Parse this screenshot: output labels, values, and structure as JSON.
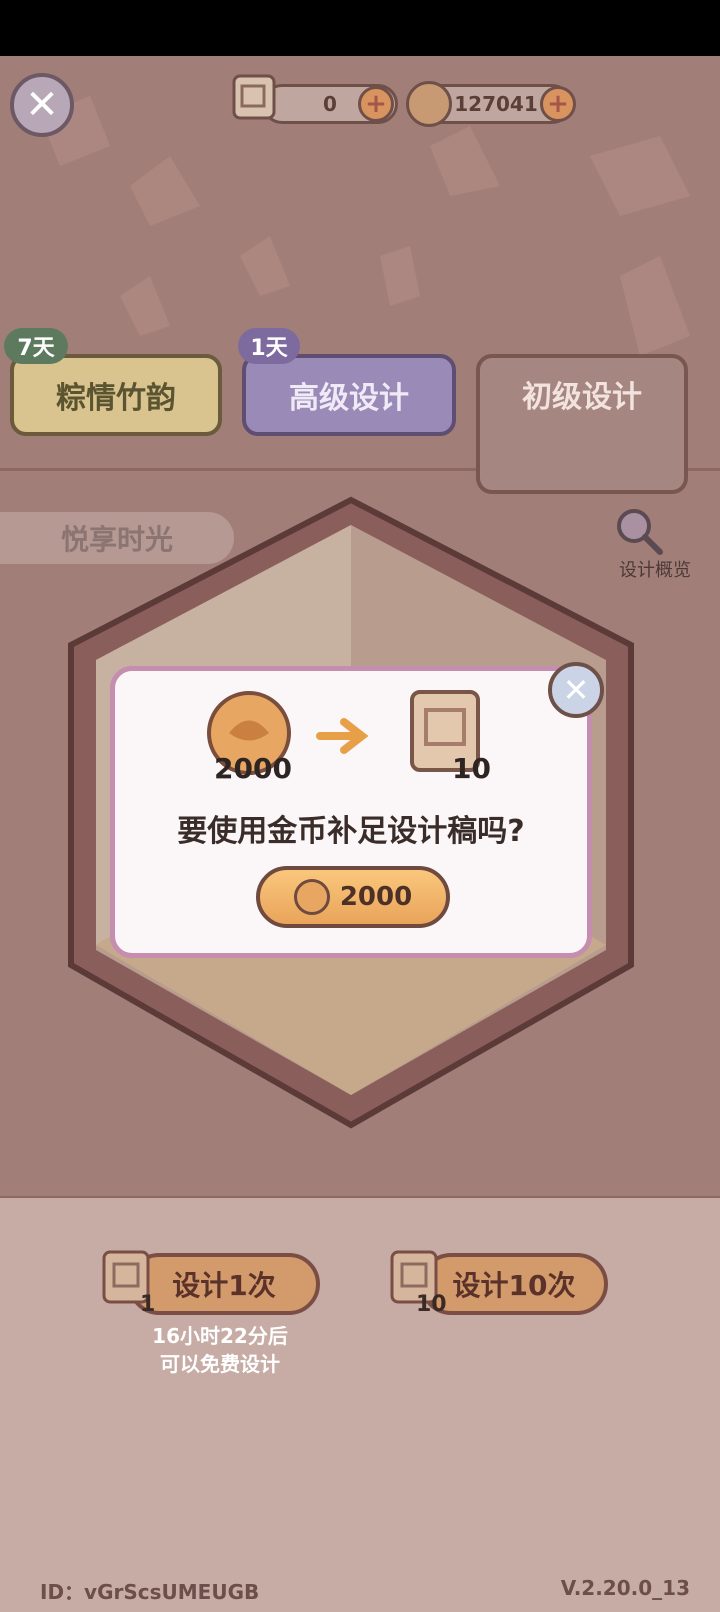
{
  "top_bar": {
    "scroll_count": "0",
    "coin_count": "127041"
  },
  "tabs": [
    {
      "label": "粽情竹韵",
      "badge": "7天"
    },
    {
      "label": "高级设计",
      "badge": "1天"
    },
    {
      "label": "初级设计"
    }
  ],
  "sidebar": {
    "theme_label": "悦享时光",
    "preview_label": "设计概览"
  },
  "modal": {
    "cost_amount": "2000",
    "reward_amount": "10",
    "question": "要使用金币补足设计稿吗?",
    "confirm_amount": "2000"
  },
  "design_buttons": [
    {
      "label": "设计1次",
      "cost": "1"
    },
    {
      "label": "设计10次",
      "cost": "10"
    }
  ],
  "free_notice": {
    "line1": "16小时22分后",
    "line2": "可以免费设计"
  },
  "footer": {
    "user_id": "ID：vGrScsUMEUGB",
    "version": "V.2.20.0_13"
  },
  "colors": {
    "accent_coin": "#e9a45a",
    "modal_border": "#c58db0",
    "tab_green": "#d9c38f",
    "tab_purple": "#9a8ab8"
  }
}
